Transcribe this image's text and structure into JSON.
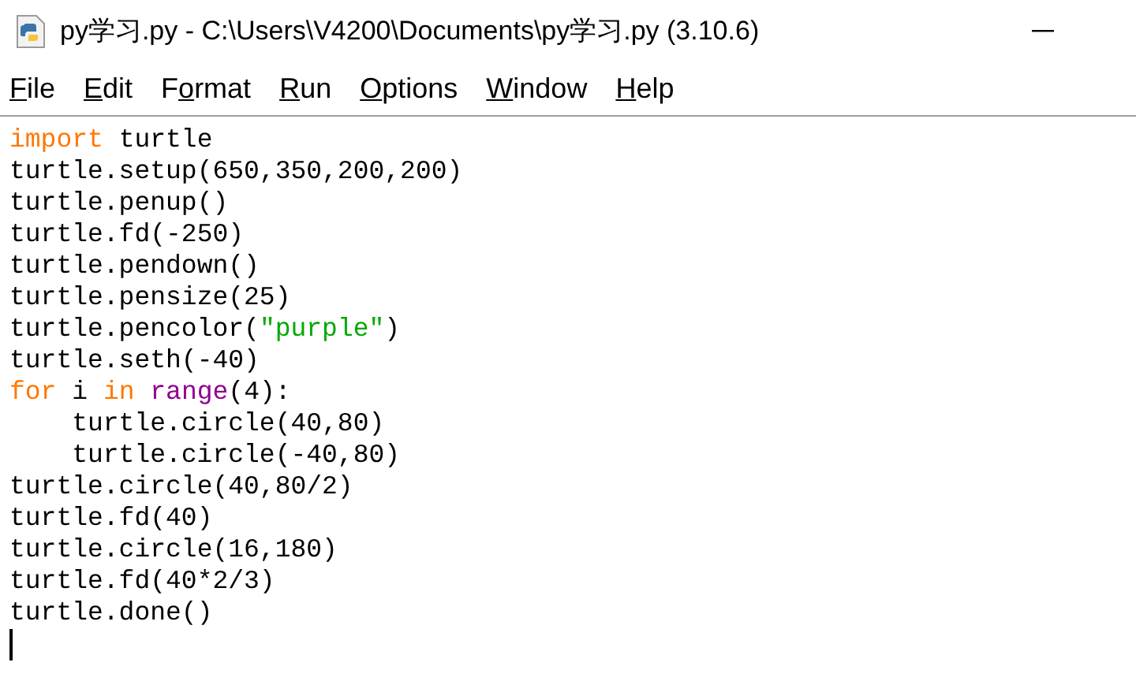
{
  "window": {
    "title": "py学习.py - C:\\Users\\V4200\\Documents\\py学习.py (3.10.6)"
  },
  "menu": [
    {
      "parts": [
        {
          "text": "F",
          "underlined": true
        },
        {
          "text": "ile",
          "underlined": false
        }
      ]
    },
    {
      "parts": [
        {
          "text": "E",
          "underlined": true
        },
        {
          "text": "dit",
          "underlined": false
        }
      ]
    },
    {
      "parts": [
        {
          "text": "F",
          "underlined": false
        },
        {
          "text": "o",
          "underlined": true
        },
        {
          "text": "rmat",
          "underlined": false
        }
      ]
    },
    {
      "parts": [
        {
          "text": "R",
          "underlined": true
        },
        {
          "text": "un",
          "underlined": false
        }
      ]
    },
    {
      "parts": [
        {
          "text": "O",
          "underlined": true
        },
        {
          "text": "ptions",
          "underlined": false
        }
      ]
    },
    {
      "parts": [
        {
          "text": "W",
          "underlined": true
        },
        {
          "text": "indow",
          "underlined": false
        }
      ]
    },
    {
      "parts": [
        {
          "text": "H",
          "underlined": true
        },
        {
          "text": "elp",
          "underlined": false
        }
      ]
    }
  ],
  "editor": {
    "lines": [
      {
        "tokens": [
          {
            "kind": "keyword",
            "text": "import"
          },
          {
            "kind": "plain",
            "text": " turtle"
          }
        ]
      },
      {
        "tokens": [
          {
            "kind": "plain",
            "text": "turtle.setup(650,350,200,200)"
          }
        ]
      },
      {
        "tokens": [
          {
            "kind": "plain",
            "text": "turtle.penup()"
          }
        ]
      },
      {
        "tokens": [
          {
            "kind": "plain",
            "text": "turtle.fd(-250)"
          }
        ]
      },
      {
        "tokens": [
          {
            "kind": "plain",
            "text": "turtle.pendown()"
          }
        ]
      },
      {
        "tokens": [
          {
            "kind": "plain",
            "text": "turtle.pensize(25)"
          }
        ]
      },
      {
        "tokens": [
          {
            "kind": "plain",
            "text": "turtle.pencolor("
          },
          {
            "kind": "string",
            "text": "\"purple\""
          },
          {
            "kind": "plain",
            "text": ")"
          }
        ]
      },
      {
        "tokens": [
          {
            "kind": "plain",
            "text": "turtle.seth(-40)"
          }
        ]
      },
      {
        "tokens": [
          {
            "kind": "keyword",
            "text": "for"
          },
          {
            "kind": "plain",
            "text": " i "
          },
          {
            "kind": "keyword",
            "text": "in "
          },
          {
            "kind": "builtin",
            "text": "range"
          },
          {
            "kind": "plain",
            "text": "(4):"
          }
        ],
        "children": [
          {
            "tokens": [
              {
                "kind": "plain",
                "text": "turtle.circle(40,80)"
              }
            ]
          },
          {
            "tokens": [
              {
                "kind": "plain",
                "text": "turtle.circle(-40,80)"
              }
            ]
          }
        ]
      },
      {
        "tokens": [
          {
            "kind": "plain",
            "text": "turtle.circle(40,80/2)"
          }
        ]
      },
      {
        "tokens": [
          {
            "kind": "plain",
            "text": "turtle.fd(40)"
          }
        ]
      },
      {
        "tokens": [
          {
            "kind": "plain",
            "text": "turtle.circle(16,180)"
          }
        ]
      },
      {
        "tokens": [
          {
            "kind": "plain",
            "text": "turtle.fd(40*2/3)"
          }
        ]
      },
      {
        "tokens": [
          {
            "kind": "plain",
            "text": "turtle.done()"
          }
        ]
      }
    ]
  }
}
